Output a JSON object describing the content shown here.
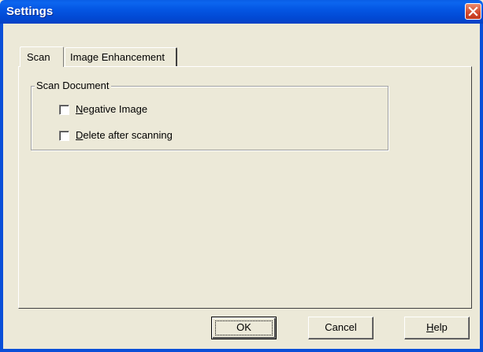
{
  "window": {
    "title": "Settings",
    "close_icon": "close-icon",
    "accent": "#0a5ee6"
  },
  "tabs": [
    {
      "label": "Scan",
      "selected": true
    },
    {
      "label": "Image Enhancement",
      "selected": false
    }
  ],
  "scan_document": {
    "group_label": "Scan Document",
    "options": [
      {
        "mnemonic": "N",
        "rest": "egative Image",
        "checked": false
      },
      {
        "mnemonic": "D",
        "rest": "elete after scanning",
        "checked": false
      }
    ]
  },
  "buttons": {
    "ok": "OK",
    "cancel": "Cancel",
    "help_mnemonic": "H",
    "help_rest": "elp"
  }
}
